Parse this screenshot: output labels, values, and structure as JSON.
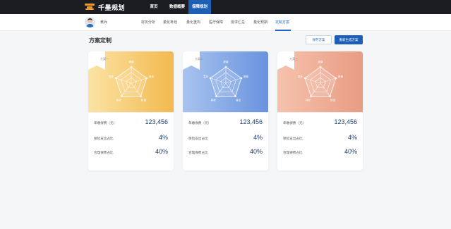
{
  "header": {
    "logo_text": "千墨规划",
    "nav": [
      "首页",
      "数据概要",
      "保障规划"
    ],
    "active_nav_index": 2,
    "colors": {
      "bar": "#1b1d22",
      "active": "#1e5fb6",
      "logo": "#f29a1d"
    }
  },
  "subheader": {
    "username": "黄兵",
    "tabs": [
      "财务分析",
      "量化筹划",
      "量化重构",
      "医疗保障",
      "需求汇总",
      "量化预期",
      "定制方案"
    ],
    "active_tab_index": 6
  },
  "section": {
    "title": "方案定制",
    "secondary_button": "保存方案",
    "primary_button": "重新生成方案"
  },
  "cards": [
    {
      "tag": "方案一",
      "axes": [
        "健康",
        "教育",
        "财富",
        "养老",
        "意外"
      ],
      "rows": [
        {
          "label": "年缴保费（元）",
          "value": "123,456"
        },
        {
          "label": "保险支出占比",
          "value": "4%"
        },
        {
          "label": "合理保费占比",
          "value": "40%"
        }
      ],
      "gradient": [
        "#fbe3a4",
        "#f3b94f"
      ]
    },
    {
      "tag": "方案二",
      "axes": [
        "健康",
        "教育",
        "财富",
        "养老",
        "意外"
      ],
      "rows": [
        {
          "label": "年缴保费（元）",
          "value": "123,456"
        },
        {
          "label": "保险支出占比",
          "value": "4%"
        },
        {
          "label": "合理保费占比",
          "value": "40%"
        }
      ],
      "gradient": [
        "#a8c3ef",
        "#6993de"
      ]
    },
    {
      "tag": "方案三",
      "axes": [
        "健康",
        "教育",
        "财富",
        "养老",
        "意外"
      ],
      "rows": [
        {
          "label": "年缴保费（元）",
          "value": "123,456"
        },
        {
          "label": "保险支出占比",
          "value": "4%"
        },
        {
          "label": "合理保费占比",
          "value": "40%"
        }
      ],
      "gradient": [
        "#f6c2ad",
        "#e89c83"
      ]
    }
  ]
}
